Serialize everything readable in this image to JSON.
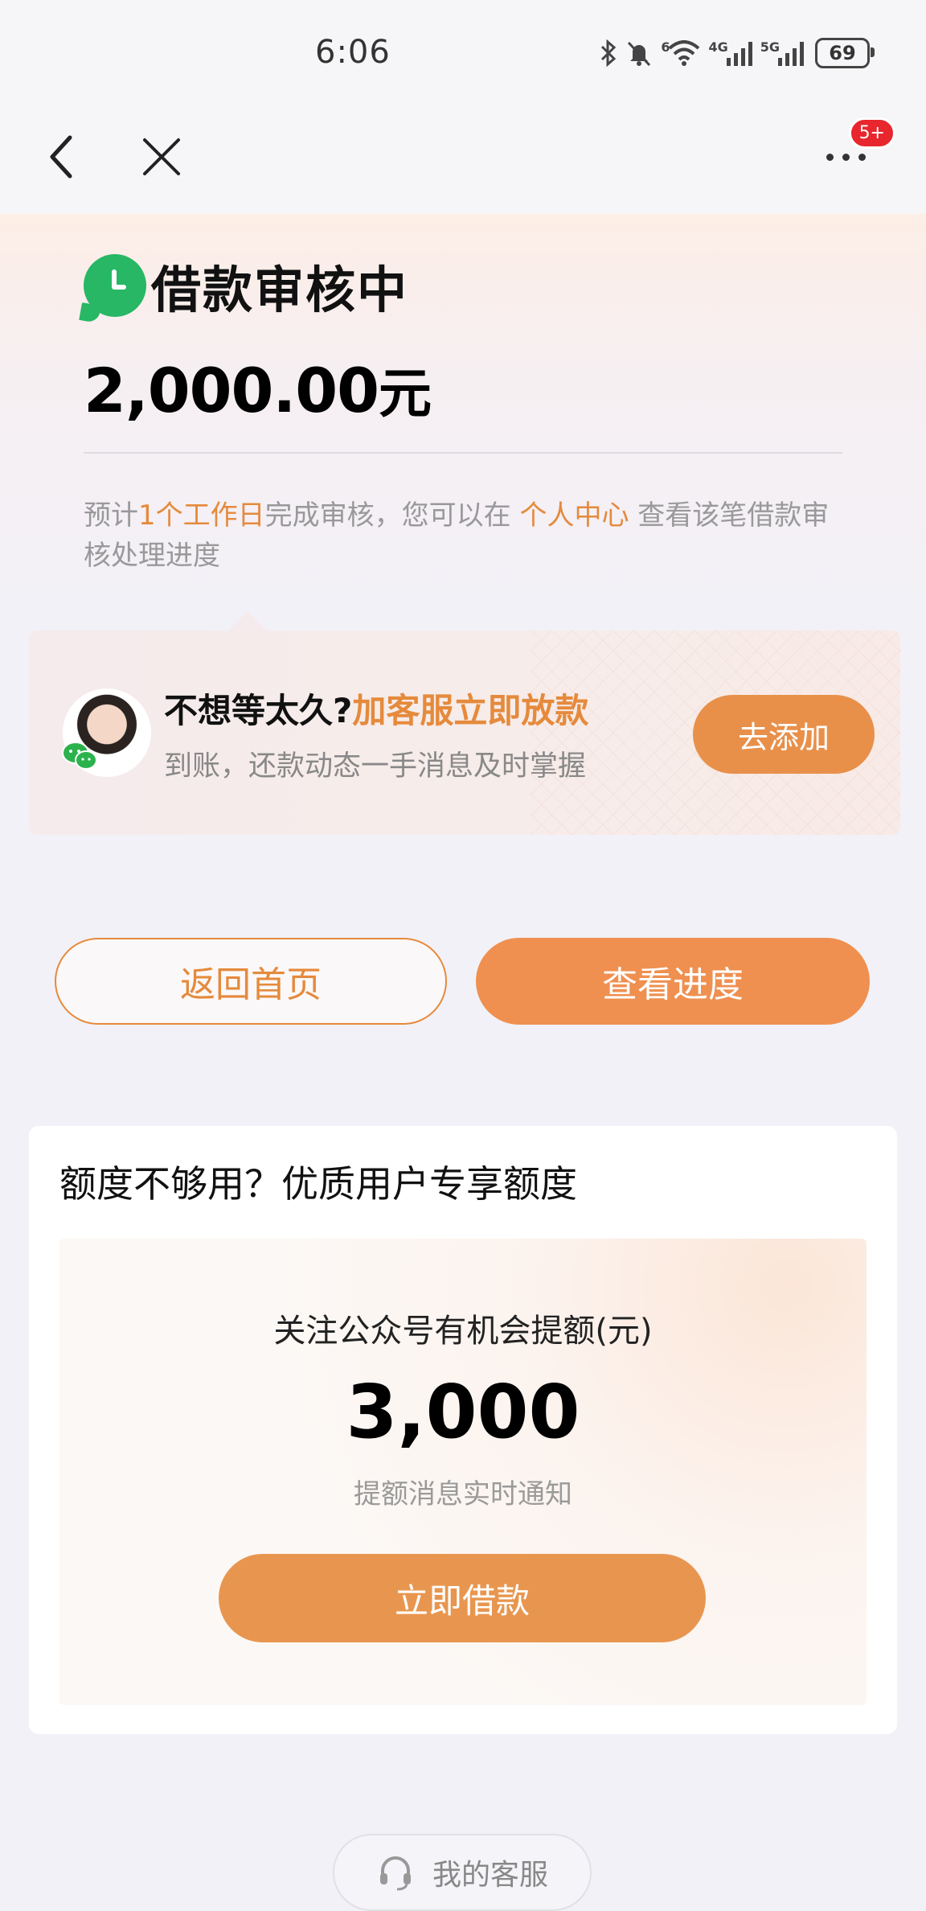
{
  "status_bar": {
    "time": "6:06",
    "icons": [
      "bluetooth-icon",
      "mute-icon",
      "wifi-icon",
      "cellular-4g-icon",
      "cellular-5g-icon"
    ],
    "wifi_label": "6",
    "net1_label": "4G",
    "net2_label": "5G",
    "battery": "69"
  },
  "nav": {
    "back_icon": "chevron-left-icon",
    "close_icon": "close-icon",
    "more_icon": "more-dots-icon",
    "badge": "5+"
  },
  "loan": {
    "status_icon": "clock-icon",
    "status": "借款审核中",
    "amount": "2,000.00",
    "amount_unit": "元",
    "desc_pre": "预计",
    "desc_hl1": "1个工作日",
    "desc_mid": "完成审核，您可以在",
    "desc_hl2": "个人中心",
    "desc_post": "查看该笔借款审核处理进度"
  },
  "promo": {
    "title_pre": "不想等太久?",
    "title_hl": "加客服立即放款",
    "subtitle": "到账，还款动态一手消息及时掌握",
    "button": "去添加"
  },
  "actions": {
    "home": "返回首页",
    "progress": "查看进度"
  },
  "quota": {
    "title": "额度不够用？优质用户专享额度",
    "label": "关注公众号有机会提额(元)",
    "amount": "3,000",
    "note": "提额消息实时通知",
    "button": "立即借款"
  },
  "service": {
    "label": "我的客服",
    "icon": "headset-icon"
  },
  "colors": {
    "accent": "#e58a3c",
    "accent_fill": "#ef9050",
    "status_green": "#27b765",
    "badge_red": "#e8262d"
  }
}
